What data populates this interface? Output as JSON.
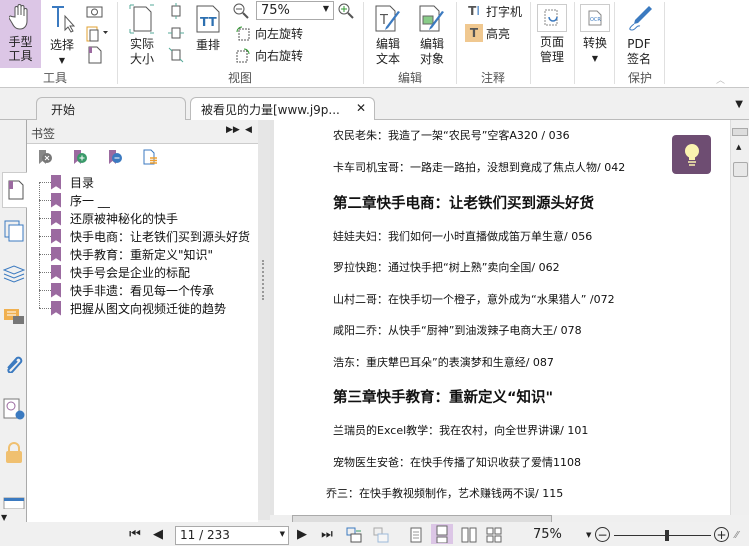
{
  "ribbon": {
    "hand_tool": "手型\n工具",
    "select": "选择",
    "group_tools": "工具",
    "actual_size": "实际\n大小",
    "reflow": "重排",
    "zoom_value": "75%",
    "rotate_left": "向左旋转",
    "rotate_right": "向右旋转",
    "group_view": "视图",
    "edit_text": "编辑\n文本",
    "edit_object": "编辑\n对象",
    "group_edit": "编辑",
    "typewriter": "打字机",
    "highlight": "高亮",
    "group_comment": "注释",
    "page_manage": "页面\n管理",
    "convert": "转换",
    "pdf_sign": "PDF\n签名",
    "group_protect": "保护"
  },
  "tabs": [
    {
      "label": "开始"
    },
    {
      "label": "被看见的力量[www.j9p..."
    }
  ],
  "bookmarks": {
    "title": "书签",
    "items": [
      "目录",
      "序一 __",
      "还原被神秘化的快手",
      "快手电商：让老铁们买到源头好货",
      "快手教育：重新定义\"知识\"",
      "快手号会是企业的标配",
      "快手非遗：看见每一个传承",
      "把握从图文向视频迁徙的趋势"
    ]
  },
  "document": {
    "lines": [
      {
        "text": "农民老朱：我造了一架“农民号”空客A320 / 036",
        "type": "entry"
      },
      {
        "text": "卡车司机宝哥：一路走一路拍，没想到竟成了焦点人物/  042",
        "type": "entry"
      },
      {
        "text": "第二章快手电商：让老铁们买到源头好货",
        "type": "chapter"
      },
      {
        "text": "娃娃夫妇：我们如何一小时直播做成笛万单生意/  056",
        "type": "entry"
      },
      {
        "text": "罗拉快跑：通过快手把“树上熟”卖向全国/  062",
        "type": "entry"
      },
      {
        "text": "山村二哥：在快手切一个橙子，意外成为“水果猎人”  /072",
        "type": "entry"
      },
      {
        "text": "咸阳二乔：从快手“厨神”到油泼辣子电商大王/  078",
        "type": "entry"
      },
      {
        "text": "浩东：重庆犨巴耳朵”的表演梦和生意经/  087",
        "type": "entry"
      },
      {
        "text": "第三章快手教育：重新定义“知识\"",
        "type": "chapter"
      },
      {
        "text": "兰瑞员的Excel教学：我在农村，向全世界讲课/  101",
        "type": "entry"
      },
      {
        "text": "宠物医生安爸：在快手传播了知识收获了爱情1108",
        "type": "entry"
      },
      {
        "text": "乔三：在快手教视频制作，艺术赚钱两不误/  115",
        "type": "entry"
      }
    ]
  },
  "status": {
    "page_input": "11 / 233",
    "zoom": "75%",
    "zoom_slider_fraction": 0.55
  },
  "colors": {
    "accent": "#9b6aa0",
    "hand_active": "#dcc6e6",
    "bulb_bg": "#6e4d72"
  }
}
